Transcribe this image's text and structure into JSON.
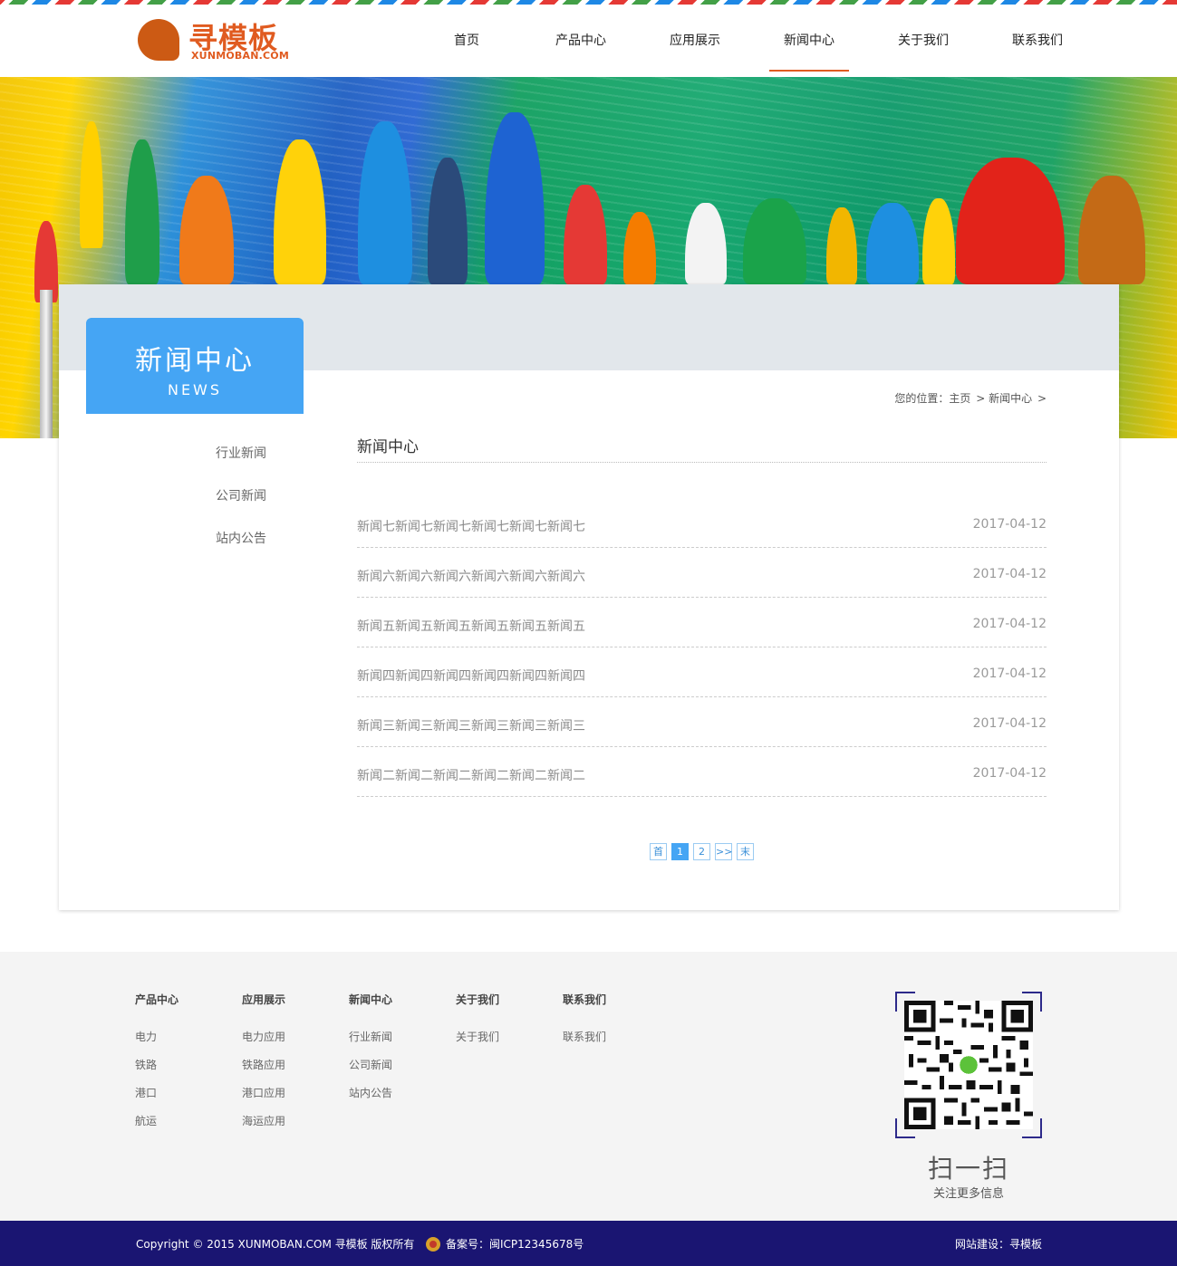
{
  "header": {
    "logo_cn": "寻模板",
    "logo_en": "XUNMOBAN.COM",
    "nav": [
      {
        "label": "首页"
      },
      {
        "label": "产品中心"
      },
      {
        "label": "应用展示"
      },
      {
        "label": "新闻中心",
        "active": true
      },
      {
        "label": "关于我们"
      },
      {
        "label": "联系我们"
      }
    ]
  },
  "colors": {
    "accent_orange": "#e05b20",
    "accent_blue": "#45a5f4",
    "footer_bar": "#1a1572"
  },
  "sidebar": {
    "title_cn": "新闻中心",
    "title_en": "NEWS",
    "items": [
      {
        "label": "行业新闻"
      },
      {
        "label": "公司新闻"
      },
      {
        "label": "站内公告"
      }
    ]
  },
  "breadcrumb": {
    "prefix": "您的位置：",
    "home": "主页",
    "sep": ">",
    "current": "新闻中心"
  },
  "main": {
    "section_title": "新闻中心",
    "news": [
      {
        "title": "新闻七新闻七新闻七新闻七新闻七新闻七",
        "date": "2017-04-12"
      },
      {
        "title": "新闻六新闻六新闻六新闻六新闻六新闻六",
        "date": "2017-04-12"
      },
      {
        "title": "新闻五新闻五新闻五新闻五新闻五新闻五",
        "date": "2017-04-12"
      },
      {
        "title": "新闻四新闻四新闻四新闻四新闻四新闻四",
        "date": "2017-04-12"
      },
      {
        "title": "新闻三新闻三新闻三新闻三新闻三新闻三",
        "date": "2017-04-12"
      },
      {
        "title": "新闻二新闻二新闻二新闻二新闻二新闻二",
        "date": "2017-04-12"
      }
    ],
    "pager": {
      "first": "首",
      "pages": [
        "1",
        "2"
      ],
      "current": "1",
      "next": ">>",
      "last": "末"
    }
  },
  "footer": {
    "columns": [
      {
        "title": "产品中心",
        "items": [
          "电力",
          "铁路",
          "港口",
          "航运"
        ]
      },
      {
        "title": "应用展示",
        "items": [
          "电力应用",
          "铁路应用",
          "港口应用",
          "海运应用"
        ]
      },
      {
        "title": "新闻中心",
        "items": [
          "行业新闻",
          "公司新闻",
          "站内公告"
        ]
      },
      {
        "title": "关于我们",
        "items": [
          "关于我们"
        ]
      },
      {
        "title": "联系我们",
        "items": [
          "联系我们"
        ]
      }
    ],
    "qr_scan": "扫一扫",
    "qr_sub": "关注更多信息",
    "copyright": "Copyright © 2015 XUNMOBAN.COM 寻模板 版权所有",
    "beian": "备案号：闽ICP12345678号",
    "build": "网站建设：寻模板"
  }
}
